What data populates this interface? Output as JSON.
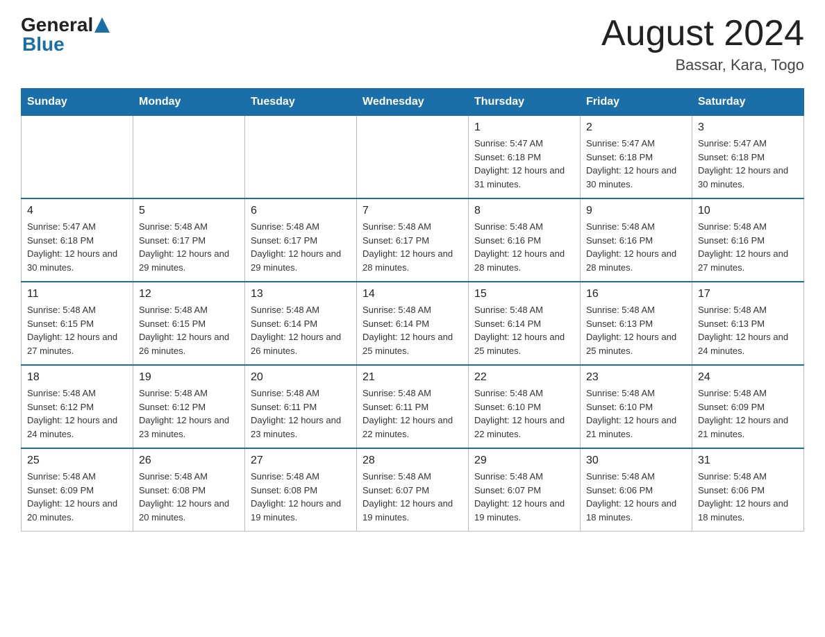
{
  "logo": {
    "general": "General",
    "blue": "Blue"
  },
  "title": "August 2024",
  "subtitle": "Bassar, Kara, Togo",
  "headers": [
    "Sunday",
    "Monday",
    "Tuesday",
    "Wednesday",
    "Thursday",
    "Friday",
    "Saturday"
  ],
  "weeks": [
    [
      {
        "day": "",
        "info": ""
      },
      {
        "day": "",
        "info": ""
      },
      {
        "day": "",
        "info": ""
      },
      {
        "day": "",
        "info": ""
      },
      {
        "day": "1",
        "info": "Sunrise: 5:47 AM\nSunset: 6:18 PM\nDaylight: 12 hours and 31 minutes."
      },
      {
        "day": "2",
        "info": "Sunrise: 5:47 AM\nSunset: 6:18 PM\nDaylight: 12 hours and 30 minutes."
      },
      {
        "day": "3",
        "info": "Sunrise: 5:47 AM\nSunset: 6:18 PM\nDaylight: 12 hours and 30 minutes."
      }
    ],
    [
      {
        "day": "4",
        "info": "Sunrise: 5:47 AM\nSunset: 6:18 PM\nDaylight: 12 hours and 30 minutes."
      },
      {
        "day": "5",
        "info": "Sunrise: 5:48 AM\nSunset: 6:17 PM\nDaylight: 12 hours and 29 minutes."
      },
      {
        "day": "6",
        "info": "Sunrise: 5:48 AM\nSunset: 6:17 PM\nDaylight: 12 hours and 29 minutes."
      },
      {
        "day": "7",
        "info": "Sunrise: 5:48 AM\nSunset: 6:17 PM\nDaylight: 12 hours and 28 minutes."
      },
      {
        "day": "8",
        "info": "Sunrise: 5:48 AM\nSunset: 6:16 PM\nDaylight: 12 hours and 28 minutes."
      },
      {
        "day": "9",
        "info": "Sunrise: 5:48 AM\nSunset: 6:16 PM\nDaylight: 12 hours and 28 minutes."
      },
      {
        "day": "10",
        "info": "Sunrise: 5:48 AM\nSunset: 6:16 PM\nDaylight: 12 hours and 27 minutes."
      }
    ],
    [
      {
        "day": "11",
        "info": "Sunrise: 5:48 AM\nSunset: 6:15 PM\nDaylight: 12 hours and 27 minutes."
      },
      {
        "day": "12",
        "info": "Sunrise: 5:48 AM\nSunset: 6:15 PM\nDaylight: 12 hours and 26 minutes."
      },
      {
        "day": "13",
        "info": "Sunrise: 5:48 AM\nSunset: 6:14 PM\nDaylight: 12 hours and 26 minutes."
      },
      {
        "day": "14",
        "info": "Sunrise: 5:48 AM\nSunset: 6:14 PM\nDaylight: 12 hours and 25 minutes."
      },
      {
        "day": "15",
        "info": "Sunrise: 5:48 AM\nSunset: 6:14 PM\nDaylight: 12 hours and 25 minutes."
      },
      {
        "day": "16",
        "info": "Sunrise: 5:48 AM\nSunset: 6:13 PM\nDaylight: 12 hours and 25 minutes."
      },
      {
        "day": "17",
        "info": "Sunrise: 5:48 AM\nSunset: 6:13 PM\nDaylight: 12 hours and 24 minutes."
      }
    ],
    [
      {
        "day": "18",
        "info": "Sunrise: 5:48 AM\nSunset: 6:12 PM\nDaylight: 12 hours and 24 minutes."
      },
      {
        "day": "19",
        "info": "Sunrise: 5:48 AM\nSunset: 6:12 PM\nDaylight: 12 hours and 23 minutes."
      },
      {
        "day": "20",
        "info": "Sunrise: 5:48 AM\nSunset: 6:11 PM\nDaylight: 12 hours and 23 minutes."
      },
      {
        "day": "21",
        "info": "Sunrise: 5:48 AM\nSunset: 6:11 PM\nDaylight: 12 hours and 22 minutes."
      },
      {
        "day": "22",
        "info": "Sunrise: 5:48 AM\nSunset: 6:10 PM\nDaylight: 12 hours and 22 minutes."
      },
      {
        "day": "23",
        "info": "Sunrise: 5:48 AM\nSunset: 6:10 PM\nDaylight: 12 hours and 21 minutes."
      },
      {
        "day": "24",
        "info": "Sunrise: 5:48 AM\nSunset: 6:09 PM\nDaylight: 12 hours and 21 minutes."
      }
    ],
    [
      {
        "day": "25",
        "info": "Sunrise: 5:48 AM\nSunset: 6:09 PM\nDaylight: 12 hours and 20 minutes."
      },
      {
        "day": "26",
        "info": "Sunrise: 5:48 AM\nSunset: 6:08 PM\nDaylight: 12 hours and 20 minutes."
      },
      {
        "day": "27",
        "info": "Sunrise: 5:48 AM\nSunset: 6:08 PM\nDaylight: 12 hours and 19 minutes."
      },
      {
        "day": "28",
        "info": "Sunrise: 5:48 AM\nSunset: 6:07 PM\nDaylight: 12 hours and 19 minutes."
      },
      {
        "day": "29",
        "info": "Sunrise: 5:48 AM\nSunset: 6:07 PM\nDaylight: 12 hours and 19 minutes."
      },
      {
        "day": "30",
        "info": "Sunrise: 5:48 AM\nSunset: 6:06 PM\nDaylight: 12 hours and 18 minutes."
      },
      {
        "day": "31",
        "info": "Sunrise: 5:48 AM\nSunset: 6:06 PM\nDaylight: 12 hours and 18 minutes."
      }
    ]
  ]
}
